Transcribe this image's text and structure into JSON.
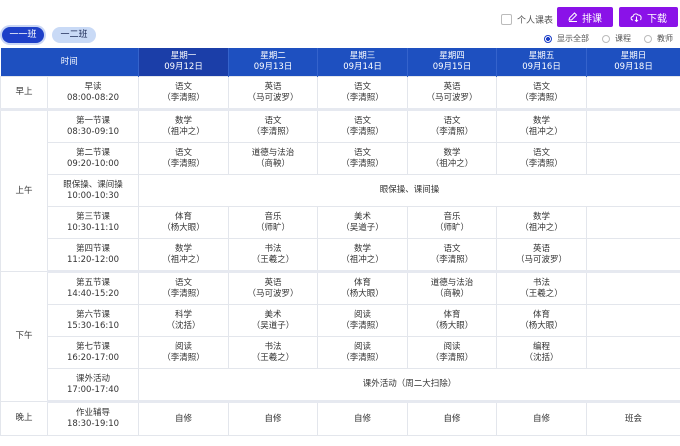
{
  "tabs": [
    "一一班",
    "一二班"
  ],
  "personal_schedule": "个人课表",
  "buttons": {
    "schedule": "排课",
    "download": "下载"
  },
  "radio_options": [
    "显示全部",
    "课程",
    "教师"
  ],
  "header": {
    "time": "时间",
    "days": [
      {
        "name": "星期一",
        "date": "09月12日"
      },
      {
        "name": "星期二",
        "date": "09月13日"
      },
      {
        "name": "星期三",
        "date": "09月14日"
      },
      {
        "name": "星期四",
        "date": "09月15日"
      },
      {
        "name": "星期五",
        "date": "09月16日"
      },
      {
        "name": "星期日",
        "date": "09月18日"
      }
    ]
  },
  "segments": {
    "morning_read": "早上",
    "am": "上午",
    "pm": "下午",
    "evening": "晚上"
  },
  "periods": [
    {
      "name": "早读",
      "time": "08:00-08:20"
    },
    {
      "name": "第一节课",
      "time": "08:30-09:10"
    },
    {
      "name": "第二节课",
      "time": "09:20-10:00"
    },
    {
      "name": "眼保操、课间操",
      "time": "10:00-10:30"
    },
    {
      "name": "第三节课",
      "time": "10:30-11:10"
    },
    {
      "name": "第四节课",
      "time": "11:20-12:00"
    },
    {
      "name": "第五节课",
      "time": "14:40-15:20"
    },
    {
      "name": "第六节课",
      "time": "15:30-16:10"
    },
    {
      "name": "第七节课",
      "time": "16:20-17:00"
    },
    {
      "name": "课外活动",
      "time": "17:00-17:40"
    },
    {
      "name": "作业辅导",
      "time": "18:30-19:10"
    }
  ],
  "merged": {
    "break": "眼保操、课间操",
    "activity": "课外活动（周二大扫除）"
  },
  "cells": {
    "r0": [
      [
        "语文",
        "（李清照）"
      ],
      [
        "英语",
        "（马可波罗）"
      ],
      [
        "语文",
        "（李清照）"
      ],
      [
        "英语",
        "（马可波罗）"
      ],
      [
        "语文",
        "（李清照）"
      ],
      [
        "",
        ""
      ]
    ],
    "r1": [
      [
        "数学",
        "（祖冲之）"
      ],
      [
        "语文",
        "（李清照）"
      ],
      [
        "语文",
        "（李清照）"
      ],
      [
        "语文",
        "（李清照）"
      ],
      [
        "数学",
        "（祖冲之）"
      ],
      [
        "",
        ""
      ]
    ],
    "r2": [
      [
        "语文",
        "（李清照）"
      ],
      [
        "道德与法治",
        "（商鞅）"
      ],
      [
        "语文",
        "（李清照）"
      ],
      [
        "数学",
        "（祖冲之）"
      ],
      [
        "语文",
        "（李清照）"
      ],
      [
        "",
        ""
      ]
    ],
    "r4": [
      [
        "体育",
        "（杨大眼）"
      ],
      [
        "音乐",
        "（师旷）"
      ],
      [
        "美术",
        "（吴道子）"
      ],
      [
        "音乐",
        "（师旷）"
      ],
      [
        "数学",
        "（祖冲之）"
      ],
      [
        "",
        ""
      ]
    ],
    "r5": [
      [
        "数学",
        "（祖冲之）"
      ],
      [
        "书法",
        "（王羲之）"
      ],
      [
        "数学",
        "（祖冲之）"
      ],
      [
        "语文",
        "（李清照）"
      ],
      [
        "英语",
        "（马可波罗）"
      ],
      [
        "",
        ""
      ]
    ],
    "r6": [
      [
        "语文",
        "（李清照）"
      ],
      [
        "英语",
        "（马可波罗）"
      ],
      [
        "体育",
        "（杨大眼）"
      ],
      [
        "道德与法治",
        "（商鞅）"
      ],
      [
        "书法",
        "（王羲之）"
      ],
      [
        "",
        ""
      ]
    ],
    "r7": [
      [
        "科学",
        "（沈括）"
      ],
      [
        "美术",
        "（吴道子）"
      ],
      [
        "阅读",
        "（李清照）"
      ],
      [
        "体育",
        "（杨大眼）"
      ],
      [
        "体育",
        "（杨大眼）"
      ],
      [
        "",
        ""
      ]
    ],
    "r8": [
      [
        "阅读",
        "（李清照）"
      ],
      [
        "书法",
        "（王羲之）"
      ],
      [
        "阅读",
        "（李清照）"
      ],
      [
        "阅读",
        "（李清照）"
      ],
      [
        "编程",
        "（沈括）"
      ],
      [
        "",
        ""
      ]
    ],
    "r10": [
      "自修",
      "自修",
      "自修",
      "自修",
      "自修",
      "班会"
    ]
  },
  "colors": {
    "header": "#1e50c0",
    "tab_active": "#1e40c8",
    "button": "#8a12e8"
  }
}
